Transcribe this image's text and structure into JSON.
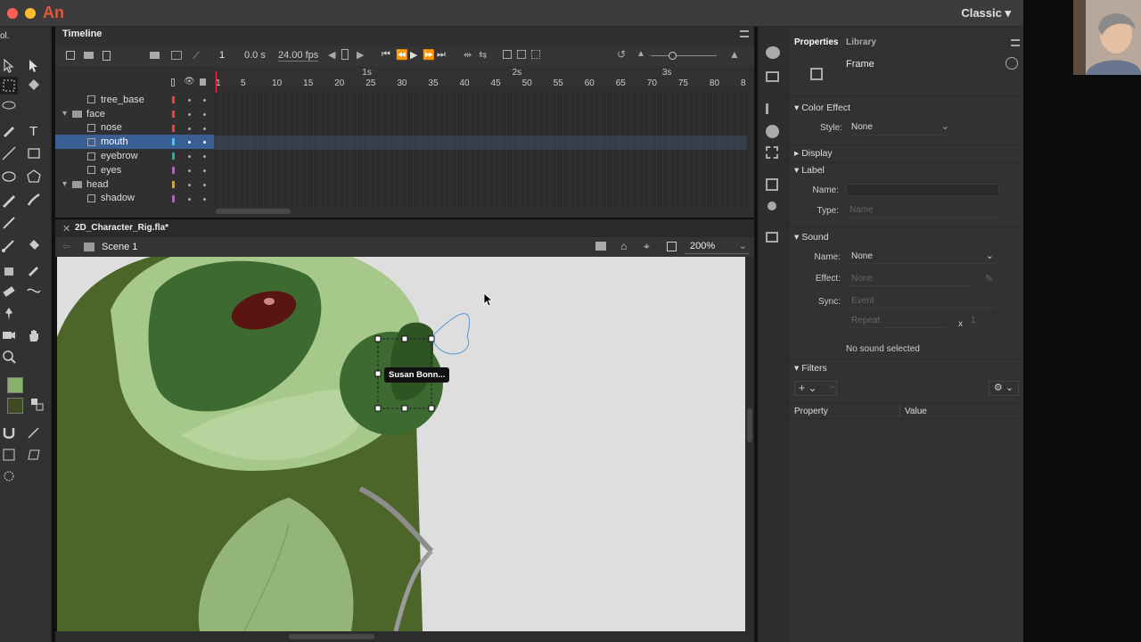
{
  "app": {
    "logo_text": "An",
    "workspace": "Classic"
  },
  "toolbar": {
    "header": "ol."
  },
  "timeline": {
    "title": "Timeline",
    "current_frame": "1",
    "time": "0.0 s",
    "fps": "24.00 fps",
    "ruler_seconds": [
      "1s",
      "2s",
      "3s"
    ],
    "ruler_frames": [
      "1",
      "5",
      "10",
      "15",
      "20",
      "25",
      "30",
      "35",
      "40",
      "45",
      "50",
      "55",
      "60",
      "65",
      "70",
      "75",
      "80",
      "8"
    ],
    "layers": [
      {
        "name": "tree_base",
        "type": "layer",
        "indent": 1,
        "color": "#ff3b30"
      },
      {
        "name": "face",
        "type": "folder",
        "indent": 0,
        "color": "#ff3b30"
      },
      {
        "name": "nose",
        "type": "layer",
        "indent": 1,
        "color": "#ff3b30"
      },
      {
        "name": "mouth",
        "type": "layer",
        "indent": 1,
        "color": "#2ed0ff",
        "selected": true
      },
      {
        "name": "eyebrow",
        "type": "layer",
        "indent": 1,
        "color": "#14b3a5"
      },
      {
        "name": "eyes",
        "type": "layer",
        "indent": 1,
        "color": "#e040fb"
      },
      {
        "name": "head",
        "type": "folder",
        "indent": 0,
        "color": "#ff9800"
      },
      {
        "name": "shadow",
        "type": "layer",
        "indent": 1,
        "color": "#e040fb"
      }
    ]
  },
  "document": {
    "tab_name": "2D_Character_Rig.fla*",
    "scene": "Scene 1",
    "zoom": "200%"
  },
  "stage": {
    "tooltip": "Susan Bonn..."
  },
  "properties": {
    "tab_properties": "Properties",
    "tab_library": "Library",
    "object_type": "Frame",
    "color_effect": {
      "heading": "Color Effect",
      "style_label": "Style:",
      "style_value": "None"
    },
    "display": {
      "heading": "Display"
    },
    "label": {
      "heading": "Label",
      "name_label": "Name:",
      "name_value": "",
      "type_label": "Type:",
      "type_value": "Name"
    },
    "sound": {
      "heading": "Sound",
      "name_label": "Name:",
      "name_value": "None",
      "effect_label": "Effect:",
      "effect_value": "None",
      "sync_label": "Sync:",
      "sync_value": "Event",
      "repeat_value": "Repeat",
      "repeat_x": "x",
      "repeat_count": "1",
      "status": "No sound selected"
    },
    "filters": {
      "heading": "Filters",
      "col_property": "Property",
      "col_value": "Value"
    }
  },
  "colors": {
    "accent": "#3a5f95",
    "panel": "#323232",
    "stage": "#dedede"
  }
}
